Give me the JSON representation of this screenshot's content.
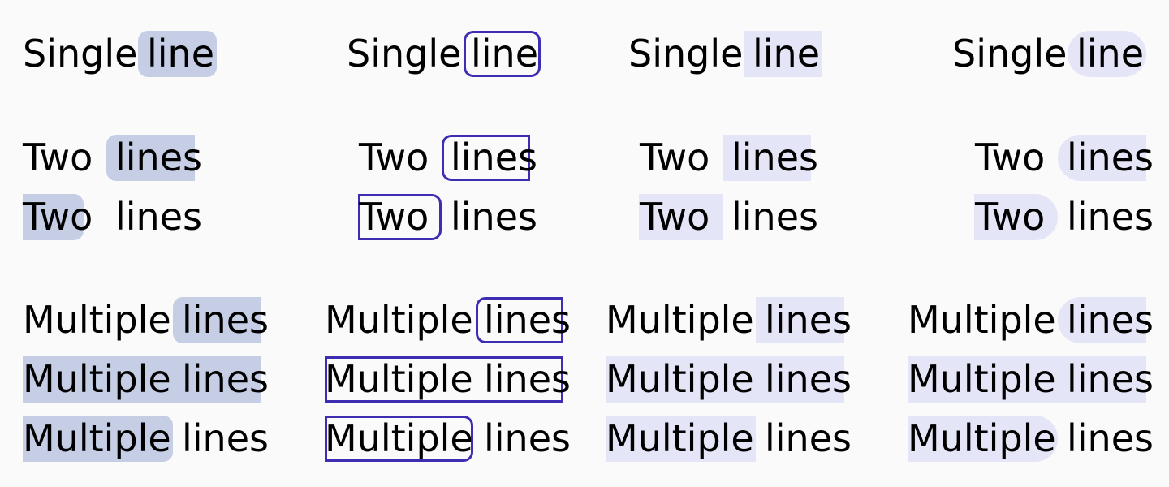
{
  "colors": {
    "page_background": "#fafafa",
    "highlight_fill_slate": "#c5cee4",
    "highlight_outline_indigo": "#3d2db3",
    "highlight_fill_lavender": "#e5e5f8",
    "text": "#000000"
  },
  "rows": [
    {
      "id": "single-line",
      "words": [
        "Single",
        "line"
      ],
      "highlighted_word": "line"
    },
    {
      "id": "two-lines-1",
      "words": [
        "Two",
        "lines"
      ],
      "highlighted_word": "lines"
    },
    {
      "id": "two-lines-2",
      "words": [
        "Two",
        "lines"
      ],
      "highlighted_word": "Two"
    },
    {
      "id": "multiple-lines-1",
      "words": [
        "Multiple",
        "lines"
      ],
      "highlighted_word": "lines"
    },
    {
      "id": "multiple-lines-2",
      "words": [
        "Multiple",
        "lines"
      ],
      "highlighted_word": "Multiple lines"
    },
    {
      "id": "multiple-lines-3",
      "words": [
        "Multiple",
        "lines"
      ],
      "highlighted_word": "Multiple"
    }
  ],
  "columns": [
    {
      "id": "col-1",
      "style": "filled-rounded",
      "fill": "#c5cee4"
    },
    {
      "id": "col-2",
      "style": "outlined-rounded",
      "stroke": "#3d2db3"
    },
    {
      "id": "col-3",
      "style": "filled-square",
      "fill": "#e5e5f8"
    },
    {
      "id": "col-4",
      "style": "filled-pill",
      "fill": "#e5e5f8"
    }
  ]
}
